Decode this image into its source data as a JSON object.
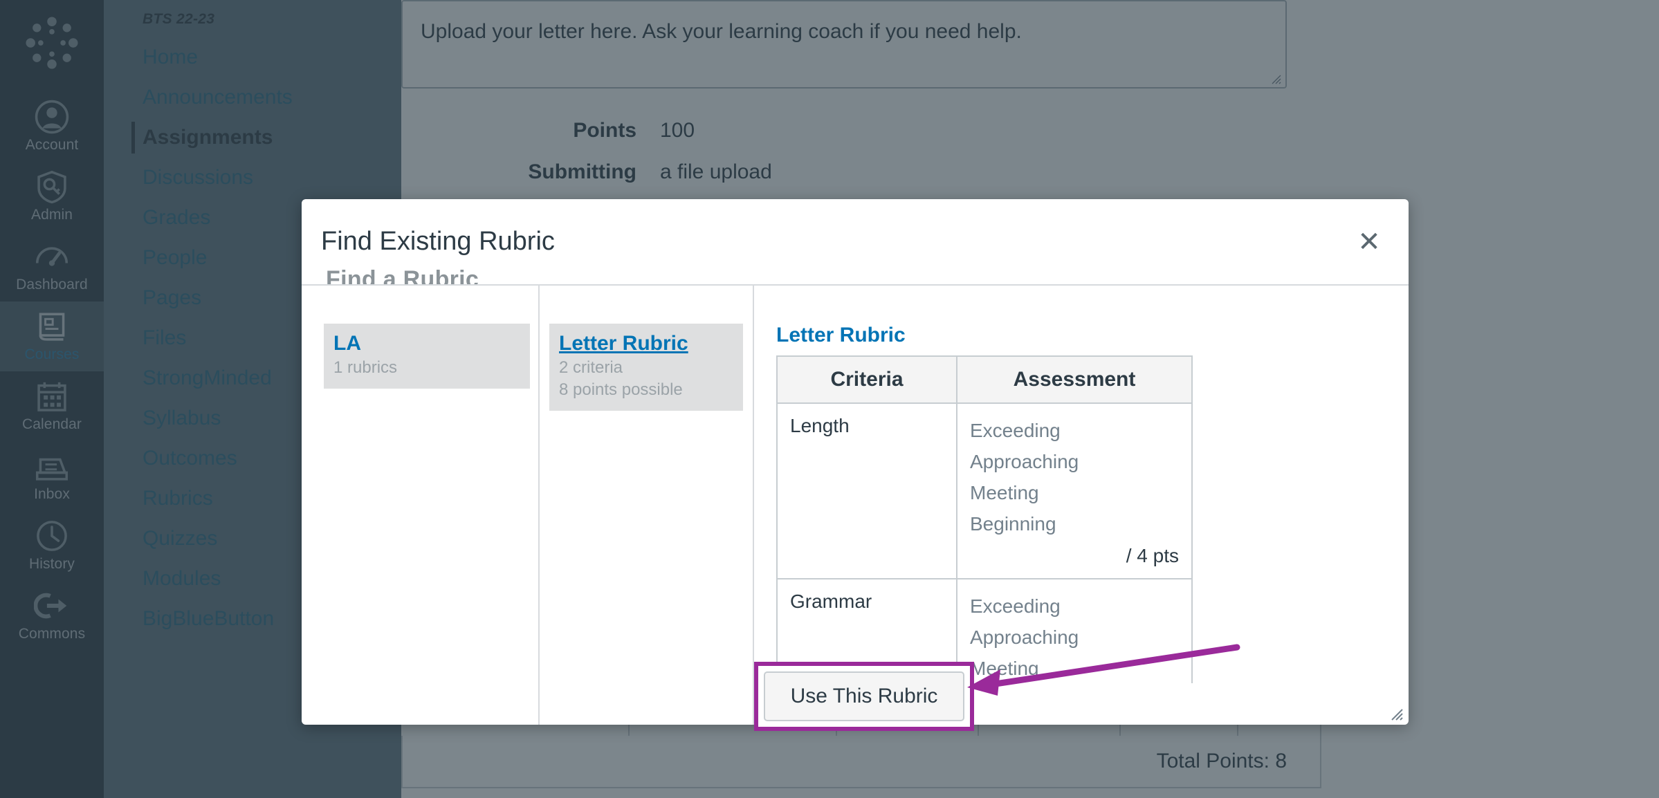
{
  "colors": {
    "global_nav_bg": "#2d3b45",
    "course_nav_bg": "#5f7480",
    "link_blue": "#0374b5",
    "annotation_purple": "#9a2a9a",
    "text_dark": "#2d3b45",
    "muted_gray": "#9ba3a8"
  },
  "global_nav": {
    "logo_icon": "canvas-logo-icon",
    "items": [
      {
        "label": "Account",
        "icon": "user-circle-icon",
        "active": false
      },
      {
        "label": "Admin",
        "icon": "shield-key-icon",
        "active": false
      },
      {
        "label": "Dashboard",
        "icon": "dashboard-icon",
        "active": false
      },
      {
        "label": "Courses",
        "icon": "book-icon",
        "active": true
      },
      {
        "label": "Calendar",
        "icon": "calendar-icon",
        "active": false
      },
      {
        "label": "Inbox",
        "icon": "inbox-icon",
        "active": false
      },
      {
        "label": "History",
        "icon": "clock-icon",
        "active": false
      },
      {
        "label": "Commons",
        "icon": "commons-arrow-icon",
        "active": false
      }
    ]
  },
  "course_nav": {
    "term": "BTS 22-23",
    "items": [
      {
        "label": "Home",
        "active": false,
        "hidden_icon": false
      },
      {
        "label": "Announcements",
        "active": false,
        "hidden_icon": true
      },
      {
        "label": "Assignments",
        "active": true,
        "hidden_icon": false
      },
      {
        "label": "Discussions",
        "active": false,
        "hidden_icon": false
      },
      {
        "label": "Grades",
        "active": false,
        "hidden_icon": false
      },
      {
        "label": "People",
        "active": false,
        "hidden_icon": false
      },
      {
        "label": "Pages",
        "active": false,
        "hidden_icon": false
      },
      {
        "label": "Files",
        "active": false,
        "hidden_icon": false
      },
      {
        "label": "StrongMinded",
        "active": false,
        "hidden_icon": false
      },
      {
        "label": "Syllabus",
        "active": false,
        "hidden_icon": false
      },
      {
        "label": "Outcomes",
        "active": false,
        "hidden_icon": false
      },
      {
        "label": "Rubrics",
        "active": false,
        "hidden_icon": false
      },
      {
        "label": "Quizzes",
        "active": false,
        "hidden_icon": false
      },
      {
        "label": "Modules",
        "active": false,
        "hidden_icon": false
      },
      {
        "label": "BigBlueButton",
        "active": false,
        "hidden_icon": false
      }
    ]
  },
  "assignment": {
    "description": "Upload your letter here. Ask your learning coach if you need help.",
    "points_label": "Points",
    "points_value": "100",
    "submitting_label": "Submitting",
    "submitting_value": "a file upload",
    "total_points": "Total Points: 8"
  },
  "modal": {
    "title": "Find Existing Rubric",
    "close_icon": "close-icon",
    "clipped_heading": "Find a Rubric",
    "resize_icon": "resize-handle-icon",
    "contexts": [
      {
        "name": "LA",
        "meta": "1 rubrics",
        "selected": true
      }
    ],
    "rubrics": [
      {
        "name": "Letter Rubric",
        "criteria_count": "2 criteria",
        "points": "8 points possible",
        "selected": true
      }
    ],
    "preview": {
      "title": "Letter Rubric",
      "headers": [
        "Criteria",
        "Assessment"
      ],
      "rows": [
        {
          "criteria": "Length",
          "ratings": [
            "Exceeding",
            "Approaching",
            "Meeting",
            "Beginning"
          ],
          "points": "/ 4 pts"
        },
        {
          "criteria": "Grammar",
          "ratings": [
            "Exceeding",
            "Approaching",
            "Meeting"
          ],
          "points": ""
        }
      ]
    },
    "use_rubric_label": "Use This Rubric"
  }
}
